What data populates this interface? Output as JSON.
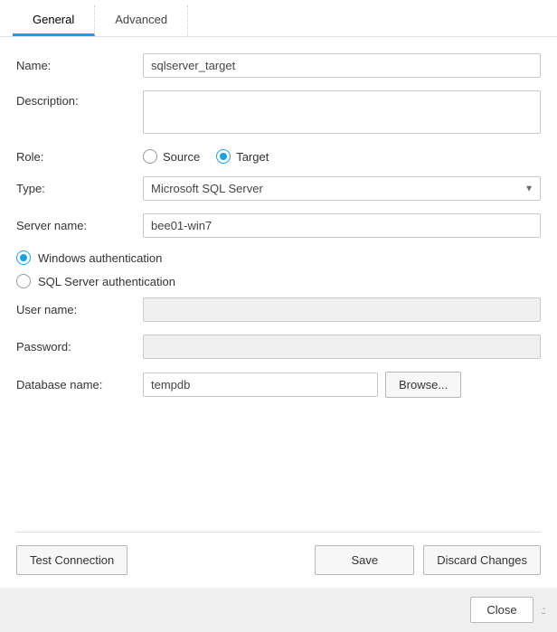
{
  "tabs": {
    "general": "General",
    "advanced": "Advanced"
  },
  "labels": {
    "name": "Name:",
    "description": "Description:",
    "role": "Role:",
    "type": "Type:",
    "server_name": "Server name:",
    "user_name": "User name:",
    "password": "Password:",
    "database_name": "Database name:"
  },
  "values": {
    "name": "sqlserver_target",
    "description": "",
    "type_selected": "Microsoft SQL Server",
    "server_name": "bee01-win7",
    "user_name": "",
    "password": "",
    "database_name": "tempdb"
  },
  "role": {
    "source": "Source",
    "target": "Target",
    "selected": "target"
  },
  "auth": {
    "windows": "Windows authentication",
    "sqlserver": "SQL Server authentication",
    "selected": "windows"
  },
  "buttons": {
    "browse": "Browse...",
    "test_connection": "Test Connection",
    "save": "Save",
    "discard_changes": "Discard Changes",
    "close": "Close"
  }
}
